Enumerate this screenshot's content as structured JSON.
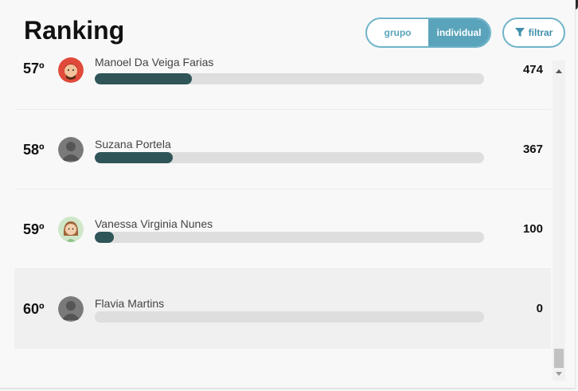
{
  "header": {
    "title": "Ranking",
    "toggle": {
      "options": [
        "grupo",
        "individual"
      ],
      "selected": "individual"
    },
    "filter_label": "filtrar"
  },
  "colors": {
    "accent": "#5aa4bb",
    "bar_fill": "#2f5558",
    "bar_track": "#dedede"
  },
  "ranking": [
    {
      "position": "57º",
      "name": "Manoel Da Veiga Farias",
      "score": "474",
      "progress": 0.25,
      "avatar": "cartoon-man-avatar"
    },
    {
      "position": "58º",
      "name": "Suzana Portela",
      "score": "367",
      "progress": 0.2,
      "avatar": "default-user-avatar"
    },
    {
      "position": "59º",
      "name": "Vanessa Virginia Nunes",
      "score": "100",
      "progress": 0.05,
      "avatar": "cartoon-woman-avatar"
    },
    {
      "position": "60º",
      "name": "Flavia Martins",
      "score": "0",
      "progress": 0.0,
      "avatar": "default-user-avatar"
    }
  ]
}
